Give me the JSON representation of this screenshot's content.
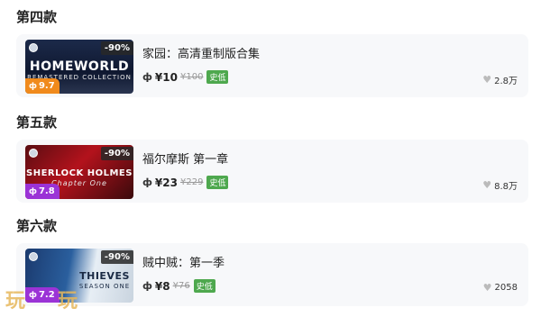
{
  "sections": [
    {
      "title": "第四款",
      "game": {
        "name": "家园：高清重制版合集",
        "discount": "-90%",
        "thumb_title": "HOMEWORLD",
        "thumb_sub": "REMASTERED COLLECTION",
        "score": "9.7",
        "score_color": "#f08a1c",
        "price": "¥10",
        "old_price": "¥100",
        "lowest_tag": "史低",
        "likes": "2.8万"
      }
    },
    {
      "title": "第五款",
      "game": {
        "name": "福尔摩斯 第一章",
        "discount": "-90%",
        "thumb_title": "SHERLOCK HOLMES",
        "thumb_sub": "Chapter One",
        "score": "7.8",
        "score_color": "#9b33d6",
        "price": "¥23",
        "old_price": "¥229",
        "lowest_tag": "史低",
        "likes": "8.8万"
      }
    },
    {
      "title": "第六款",
      "game": {
        "name": "贼中贼：第一季",
        "discount": "-90%",
        "thumb_title": "THIEVES",
        "thumb_sub": "SEASON ONE",
        "score": "7.2",
        "score_color": "#9b33d6",
        "price": "¥8",
        "old_price": "¥76",
        "lowest_tag": "史低",
        "likes": "2058"
      }
    }
  ],
  "watermark": [
    "玩",
    "玩"
  ],
  "icons": {
    "steam": "steam-icon",
    "score": "k-icon",
    "price": "k-icon",
    "likes": "heart-icon"
  }
}
